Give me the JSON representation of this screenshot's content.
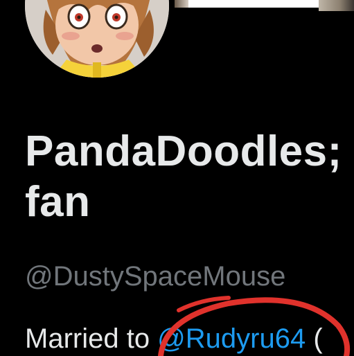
{
  "profile": {
    "display_name_line1": "PandaDoodles;",
    "display_name_line2": "fan",
    "handle": "@DustySpaceMouse",
    "bio_prefix": "Married to ",
    "bio_mention": "@Rudyru64",
    "bio_suffix": " ("
  },
  "icons": {
    "avatar": "profile-avatar",
    "annotation": "red-circle-markup"
  },
  "colors": {
    "background": "#000000",
    "primary_text": "#e7e9ea",
    "secondary_text": "#71767b",
    "link": "#1d9bf0",
    "annotation": "#e0322c"
  }
}
